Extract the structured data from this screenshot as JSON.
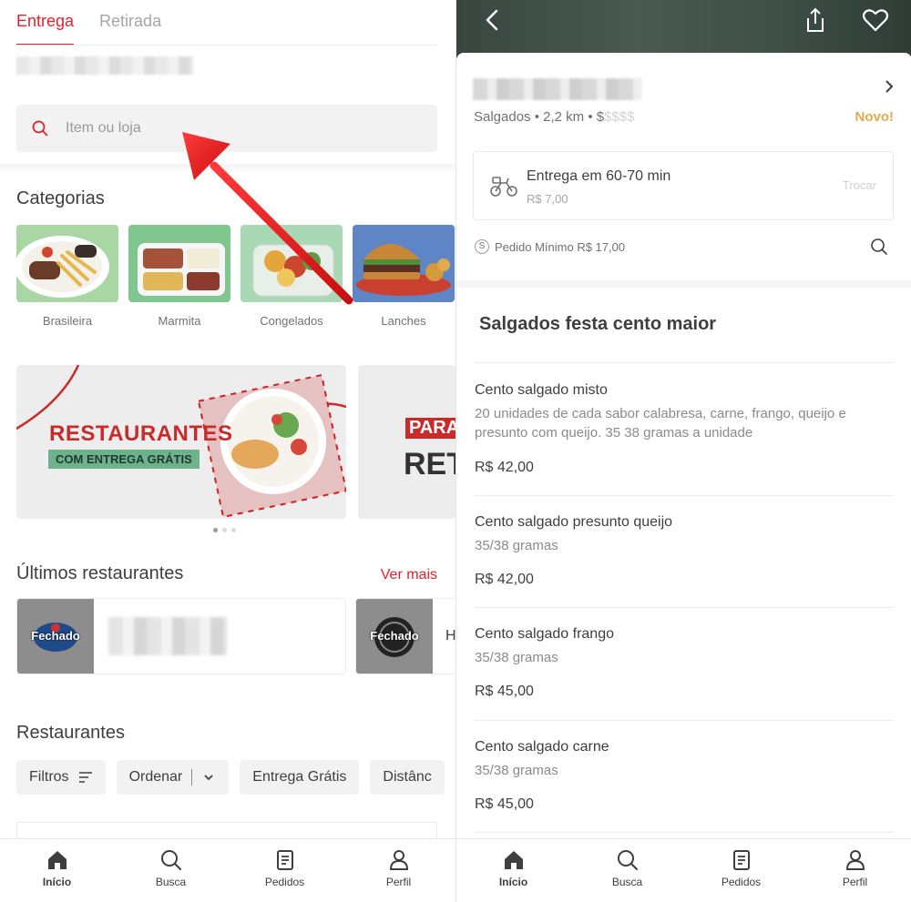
{
  "left": {
    "tabs": [
      {
        "label": "Entrega",
        "active": true
      },
      {
        "label": "Retirada",
        "active": false
      }
    ],
    "search": {
      "placeholder": "Item ou loja"
    },
    "categories_title": "Categorias",
    "categories": [
      {
        "label": "Brasileira"
      },
      {
        "label": "Marmita"
      },
      {
        "label": "Congelados"
      },
      {
        "label": "Lanches"
      }
    ],
    "banners": [
      {
        "title": "RESTAURANTES",
        "subtitle": "COM ENTREGA GRÁTIS"
      },
      {
        "title": "PARA",
        "subtitle": "RET"
      }
    ],
    "carousel": {
      "count": 3,
      "active": 0
    },
    "recent_title": "Últimos restaurantes",
    "ver_mais": "Ver mais",
    "recent": [
      {
        "status": "Fechado"
      },
      {
        "status": "Fechado",
        "name_peek": "H"
      }
    ],
    "restaurants_title": "Restaurantes",
    "chips": [
      {
        "label": "Filtros"
      },
      {
        "label": "Ordenar"
      },
      {
        "label": "Entrega Grátis"
      },
      {
        "label": "Distânc"
      }
    ]
  },
  "right": {
    "store": {
      "meta": "Salgados • 2,2 km • ",
      "price_level_active": "$",
      "price_level_inactive": "$$$$",
      "badge": "Novo!"
    },
    "delivery": {
      "title": "Entrega em 60-70 min",
      "fee": "R$ 7,00",
      "change_label": "Trocar"
    },
    "min_order": {
      "icon_text": "S",
      "label": "Pedido Mínimo R$ 17,00"
    },
    "menu_title": "Salgados festa cento maior",
    "items": [
      {
        "name": "Cento salgado misto",
        "desc": "20 unidades de cada sabor calabresa, carne, frango, queijo e presunto com queijo. 35 38 gramas a unidade",
        "price": "R$ 42,00"
      },
      {
        "name": "Cento salgado presunto queijo",
        "desc": "35/38 gramas",
        "price": "R$ 42,00"
      },
      {
        "name": "Cento salgado frango",
        "desc": "35/38 gramas",
        "price": "R$ 45,00"
      },
      {
        "name": "Cento salgado carne",
        "desc": "35/38 gramas",
        "price": "R$ 45,00"
      }
    ]
  },
  "nav": [
    {
      "label": "Início",
      "icon": "home-icon",
      "active": true
    },
    {
      "label": "Busca",
      "icon": "search-icon",
      "active": false
    },
    {
      "label": "Pedidos",
      "icon": "orders-icon",
      "active": false
    },
    {
      "label": "Perfil",
      "icon": "profile-icon",
      "active": false
    }
  ],
  "colors": {
    "brand_red": "#ea1d2c",
    "text": "#3e3e3e",
    "muted": "#717171",
    "novo_gold": "#e7a74e"
  }
}
